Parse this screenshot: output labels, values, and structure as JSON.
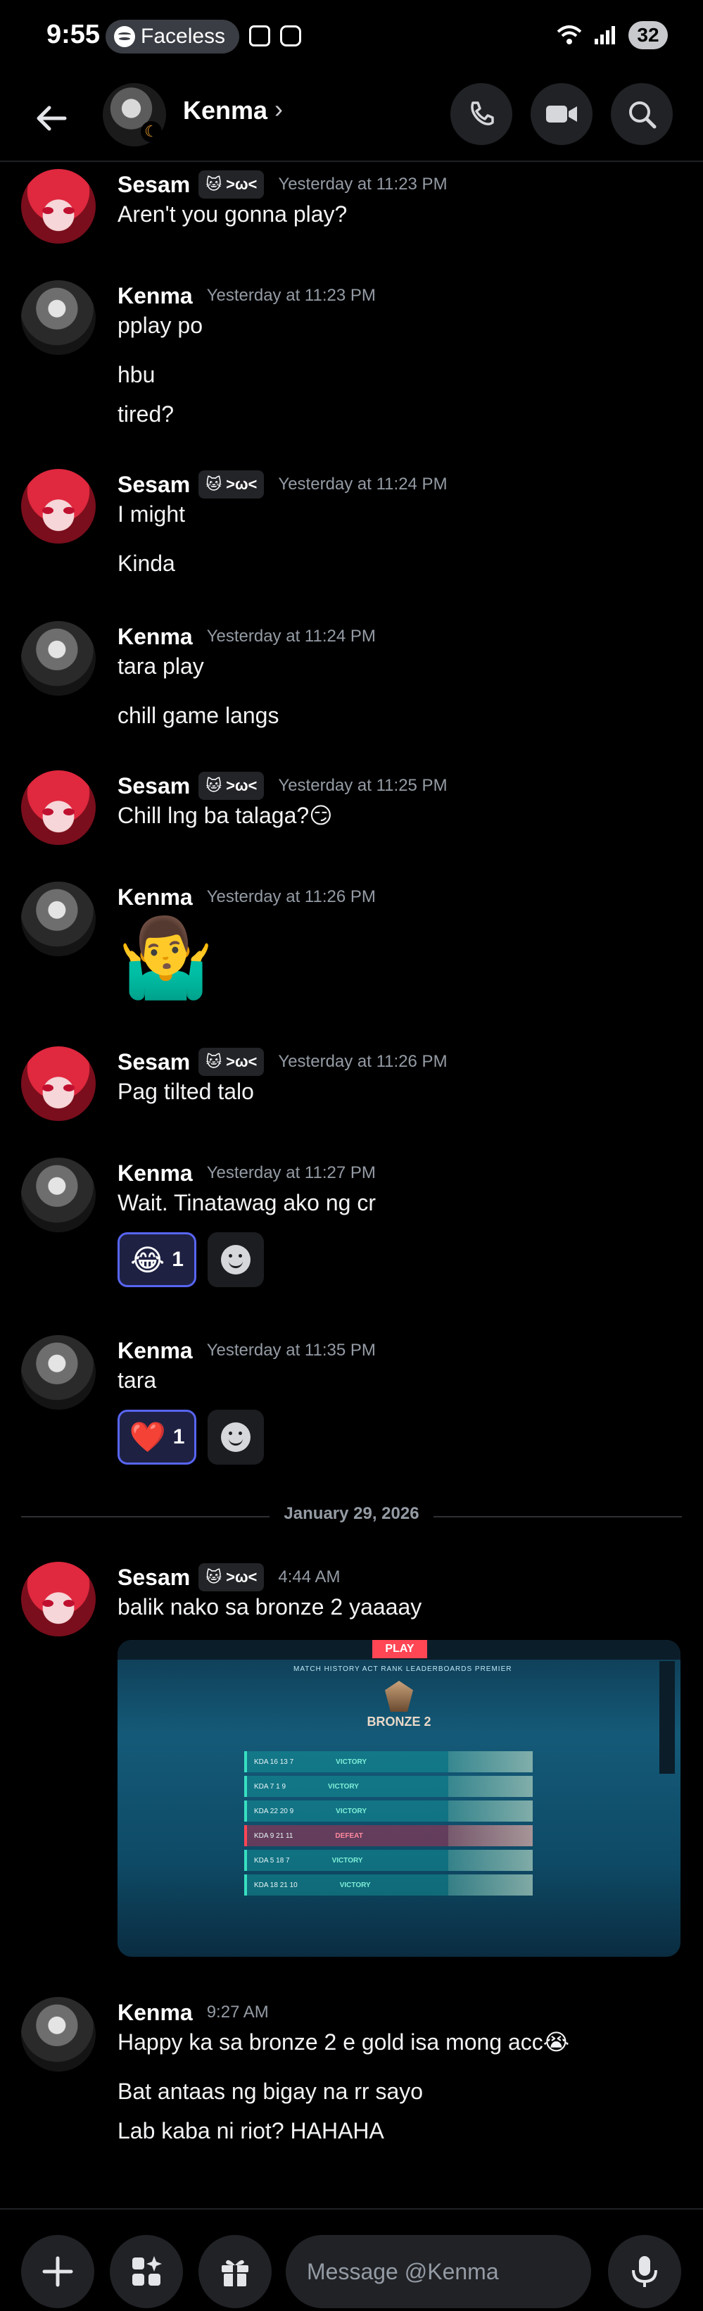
{
  "status_bar": {
    "time": "9:55",
    "media_label": "Faceless",
    "battery": "32"
  },
  "header": {
    "contact_name": "Kenma",
    "chevron": "›"
  },
  "messages": [
    {
      "author": "Sesam",
      "tag": ">ω<",
      "time": "Yesterday at 11:23 PM",
      "lines": [
        "Aren't you gonna play?"
      ]
    },
    {
      "author": "Kenma",
      "time": "Yesterday at 11:23 PM",
      "lines": [
        "pplay po",
        "hbu",
        "tired?"
      ]
    },
    {
      "author": "Sesam",
      "tag": ">ω<",
      "time": "Yesterday at 11:24 PM",
      "lines": [
        "I might",
        "Kinda"
      ]
    },
    {
      "author": "Kenma",
      "time": "Yesterday at 11:24 PM",
      "lines": [
        "tara play",
        "chill game langs"
      ]
    },
    {
      "author": "Sesam",
      "tag": ">ω<",
      "time": "Yesterday at 11:25 PM",
      "lines": [
        "Chill lng ba talaga?😏"
      ]
    },
    {
      "author": "Kenma",
      "time": "Yesterday at 11:26 PM",
      "lines": [
        "🤷‍♂️"
      ]
    },
    {
      "author": "Sesam",
      "tag": ">ω<",
      "time": "Yesterday at 11:26 PM",
      "lines": [
        "Pag tilted talo"
      ]
    },
    {
      "author": "Kenma",
      "time": "Yesterday at 11:27 PM",
      "lines": [
        "Wait. Tinatawag ako ng cr"
      ],
      "reaction": {
        "emoji": "😂",
        "count": "1"
      }
    },
    {
      "author": "Kenma",
      "time": "Yesterday at 11:35 PM",
      "lines": [
        "tara"
      ],
      "reaction": {
        "emoji": "❤️",
        "count": "1"
      }
    },
    {
      "author": "Sesam",
      "tag": ">ω<",
      "time": "4:44 AM",
      "lines": [
        "balik nako sa bronze 2 yaaaay"
      ]
    },
    {
      "author": "Kenma",
      "time": "9:27 AM",
      "lines": [
        "Happy ka sa bronze 2 e gold isa mong acc😭",
        "Bat antaas ng bigay na rr sayo",
        "Lab kaba ni riot? HAHAHA"
      ]
    }
  ],
  "date_divider": "January 29, 2026",
  "attachment": {
    "play_label": "PLAY",
    "tabs": "MATCH HISTORY    ACT RANK    LEADERBOARDS    PREMIER",
    "rank": "BRONZE 2",
    "rows": [
      {
        "kda": "KDA  16 13 7",
        "result": "VICTORY",
        "defeat": false
      },
      {
        "kda": "KDA  7 1 9",
        "result": "VICTORY",
        "defeat": false
      },
      {
        "kda": "KDA  22 20 9",
        "result": "VICTORY",
        "defeat": false
      },
      {
        "kda": "KDA  9 21 11",
        "result": "DEFEAT",
        "defeat": true
      },
      {
        "kda": "KDA  5 18 7",
        "result": "VICTORY",
        "defeat": false
      },
      {
        "kda": "KDA  18 21 10",
        "result": "VICTORY",
        "defeat": false
      }
    ]
  },
  "composer": {
    "placeholder": "Message @Kenma"
  },
  "icons": [
    "back-arrow-icon",
    "phone-icon",
    "video-icon",
    "search-icon",
    "plus-icon",
    "apps-icon",
    "gift-icon",
    "emoji-icon",
    "microphone-icon",
    "add-reaction-icon"
  ]
}
